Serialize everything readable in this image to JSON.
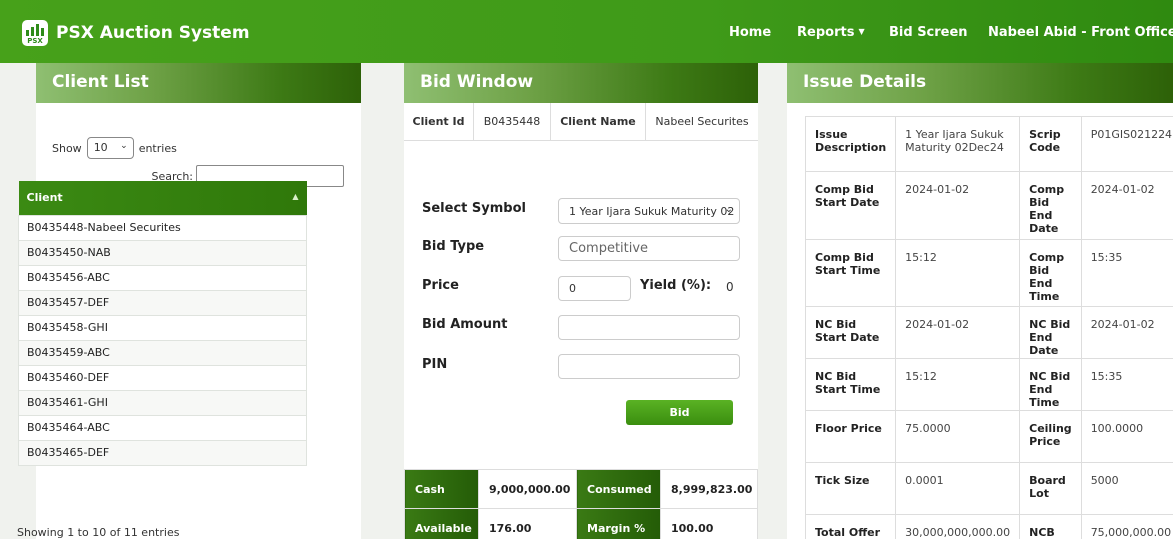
{
  "navbar": {
    "logo_text": "PSX",
    "brand": "PSX Auction System",
    "items": {
      "home": "Home",
      "reports": "Reports",
      "bid_screen": "Bid Screen",
      "user": "Nabeel Abid - Front Office"
    }
  },
  "client_list": {
    "title": "Client List",
    "show_label": "Show",
    "entries_value": "10",
    "entries_label": "entries",
    "search_label": "Search:",
    "search_value": "",
    "column": "Client",
    "rows": [
      "B0435448-Nabeel Securites",
      "B0435450-NAB",
      "B0435456-ABC",
      "B0435457-DEF",
      "B0435458-GHI",
      "B0435459-ABC",
      "B0435460-DEF",
      "B0435461-GHI",
      "B0435464-ABC",
      "B0435465-DEF"
    ],
    "info": "Showing 1 to 10 of 11 entries"
  },
  "bid_window": {
    "title": "Bid Window",
    "client_id_label": "Client Id",
    "client_id": "B0435448",
    "client_name_label": "Client Name",
    "client_name": "Nabeel Securites",
    "symbol_label": "Select Symbol",
    "symbol_value": "1 Year Ijara Sukuk Maturity 02",
    "bid_type_label": "Bid Type",
    "bid_type_value": "Competitive",
    "price_label": "Price",
    "price_value": "0",
    "yield_label": "Yield (%):",
    "yield_value": "0",
    "bid_amount_label": "Bid Amount",
    "bid_amount_value": "",
    "pin_label": "PIN",
    "pin_value": "",
    "bid_button": "Bid",
    "summary": {
      "cash_label": "Cash",
      "cash": "9,000,000.00",
      "consumed_label": "Consumed",
      "consumed": "8,999,823.00",
      "available_label": "Available",
      "available": "176.00",
      "margin_label": "Margin %",
      "margin": "100.00"
    }
  },
  "issue_details": {
    "title": "Issue Details",
    "rows": [
      {
        "l1": "Issue Description",
        "v1": "1 Year Ijara Sukuk Maturity 02Dec24",
        "l2": "Scrip Code",
        "v2": "P01GIS021224"
      },
      {
        "l1": "Comp Bid Start Date",
        "v1": "2024-01-02",
        "l2": "Comp Bid End Date",
        "v2": "2024-01-02"
      },
      {
        "l1": "Comp Bid Start Time",
        "v1": "15:12",
        "l2": "Comp Bid End Time",
        "v2": "15:35"
      },
      {
        "l1": "NC Bid Start Date",
        "v1": "2024-01-02",
        "l2": "NC Bid End Date",
        "v2": "2024-01-02"
      },
      {
        "l1": "NC Bid Start Time",
        "v1": "15:12",
        "l2": "NC Bid End Time",
        "v2": "15:35"
      },
      {
        "l1": "Floor Price",
        "v1": "75.0000",
        "l2": "Ceiling Price",
        "v2": "100.0000"
      },
      {
        "l1": "Tick Size",
        "v1": "0.0001",
        "l2": "Board Lot",
        "v2": "5000"
      },
      {
        "l1": "Total Offer",
        "v1": "30,000,000,000.00",
        "l2": "NCB Max",
        "v2": "75,000,000.00"
      }
    ]
  }
}
